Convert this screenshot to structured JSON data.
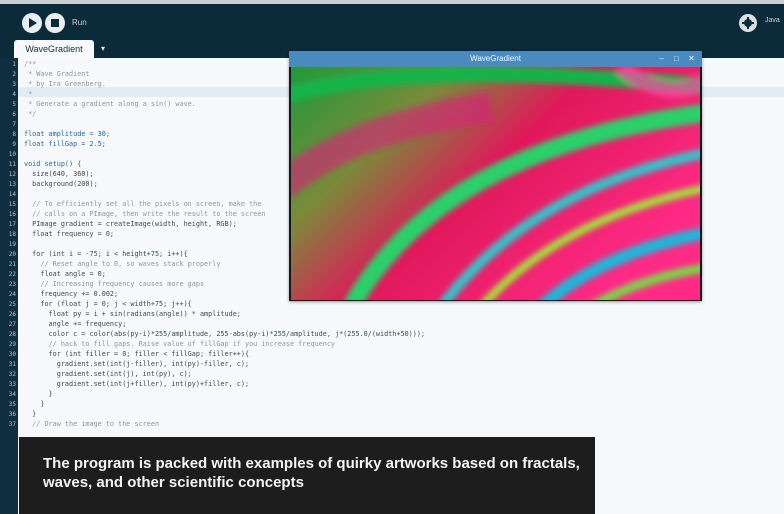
{
  "toolbar": {
    "run_label": "Run",
    "mode_label": "Java"
  },
  "tab": {
    "name": "WaveGradient",
    "menu_arrow": "▾"
  },
  "sketch_window": {
    "title": "WaveGradient",
    "minimize": "–",
    "maximize": "□",
    "close": "✕"
  },
  "code": {
    "line_numbers": [
      "1",
      "2",
      "3",
      "4",
      "5",
      "6",
      "7",
      "8",
      "9",
      "10",
      "11",
      "12",
      "13",
      "14",
      "15",
      "16",
      "17",
      "18",
      "19",
      "20",
      "21",
      "22",
      "23",
      "24",
      "25",
      "26",
      "27",
      "28",
      "29",
      "30",
      "31",
      "32",
      "33",
      "34",
      "35",
      "36",
      "37"
    ],
    "lines": [
      "/**",
      " * Wave Gradient",
      " * by Ira Greenberg.",
      " *",
      " * Generate a gradient along a sin() wave.",
      " */",
      "",
      "float amplitude = 30;",
      "float fillGap = 2.5;",
      "",
      "void setup() {",
      "  size(640, 360);",
      "  background(200);",
      "",
      "  // To efficiently set all the pixels on screen, make the",
      "  // calls on a PImage, then write the result to the screen",
      "  PImage gradient = createImage(width, height, RGB);",
      "  float frequency = 0;",
      "",
      "  for (int i = -75; i < height+75; i++){",
      "    // Reset angle to 0, so waves stack properly",
      "    float angle = 0;",
      "    // Increasing frequency causes more gaps",
      "    frequency += 0.002;",
      "    for (float j = 0; j < width+75; j++){",
      "      float py = i + sin(radians(angle)) * amplitude;",
      "      angle += frequency;",
      "      color c = color(abs(py-i)*255/amplitude, 255-abs(py-i)*255/amplitude, j*(255.0/(width+50)));",
      "      // hack to fill gaps. Raise value of fillGap if you increase frequency",
      "      for (int filler = 0; filler < fillGap; filler++){",
      "        gradient.set(int(j-filler), int(py)-filler, c);",
      "        gradient.set(int(j), int(py), c);",
      "        gradient.set(int(j+filler), int(py)+filler, c);",
      "      }",
      "    }",
      "  }",
      "  // Draw the image to the screen"
    ],
    "line_styles": [
      "cm",
      "cm",
      "cm",
      "cm",
      "cm",
      "cm",
      "",
      "bl",
      "bl",
      "",
      "bl",
      "",
      "",
      "",
      "cm",
      "cm",
      "",
      "",
      "",
      "",
      "cm",
      "",
      "cm",
      "",
      "",
      "",
      "",
      "",
      "cm",
      "",
      "",
      "",
      "",
      "",
      "",
      "",
      "cm"
    ]
  },
  "caption": {
    "text": "The program is packed with examples of quirky artworks based on fractals, waves, and other scientific concepts"
  },
  "colors": {
    "toolbar": "#0b2a3a",
    "window_title": "#4a8bbf",
    "caption_bg": "#1d1d1d"
  }
}
